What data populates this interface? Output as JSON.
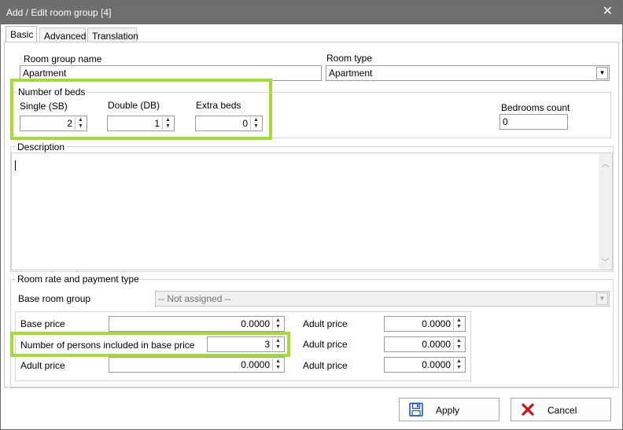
{
  "window": {
    "title": "Add / Edit room group [4]",
    "close_glyph": "✕"
  },
  "tabs": [
    {
      "label": "Basic",
      "active": true
    },
    {
      "label": "Advanced",
      "active": false
    },
    {
      "label": "Translation",
      "active": false
    }
  ],
  "basic": {
    "room_group_name_label": "Room group name",
    "room_group_name_value": "Apartment",
    "room_type_label": "Room type",
    "room_type_value": "Apartment",
    "beds": {
      "group_title": "Number of beds",
      "single_label": "Single (SB)",
      "single_value": "2",
      "double_label": "Double (DB)",
      "double_value": "1",
      "extra_label": "Extra beds",
      "extra_value": "0"
    },
    "bedrooms_label": "Bedrooms count",
    "bedrooms_value": "0",
    "description_label": "Description",
    "description_value": ""
  },
  "rate": {
    "group_title": "Room rate and payment type",
    "base_room_group_label": "Base room group",
    "base_room_group_value": "-- Not assigned --",
    "base_price_label": "Base price",
    "base_price_value": "0.0000",
    "persons_label": "Number of persons included in base price",
    "persons_value": "3",
    "adult_price_label": "Adult price",
    "adult_price_value": "0.0000",
    "right_rows": [
      {
        "label": "Adult price",
        "value": "0.0000"
      },
      {
        "label": "Adult price",
        "value": "0.0000"
      },
      {
        "label": "Adult price",
        "value": "0.0000"
      }
    ]
  },
  "buttons": {
    "apply": "Apply",
    "cancel": "Cancel"
  },
  "colors": {
    "highlight": "#a6d93a",
    "titlebar": "#6e6e6e",
    "cancel_icon": "#c0161b",
    "apply_icon": "#1f5aa8"
  },
  "icons": {
    "apply": "save-icon",
    "cancel": "cancel-x-icon"
  }
}
